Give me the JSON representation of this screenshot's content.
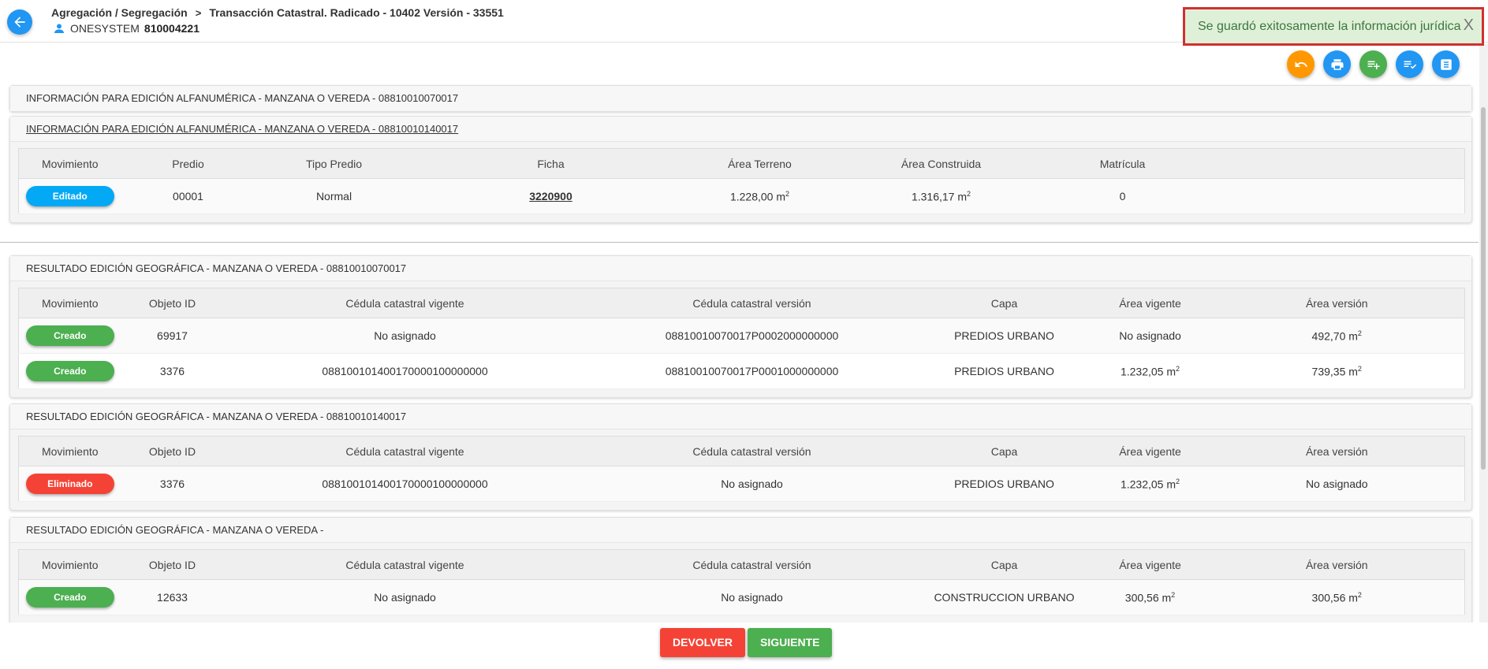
{
  "header": {
    "breadcrumb_section": "Agregación / Segregación",
    "breadcrumb_page": "Transacción Catastral. Radicado - 10402 Versión - 33551",
    "user_name": "ONESYSTEM",
    "user_id": "810004221"
  },
  "toast": {
    "message": "Se guardó exitosamente la información jurídica",
    "close": "X"
  },
  "toolbar": [
    {
      "icon": "undo-icon",
      "color": "#ff9800"
    },
    {
      "icon": "print-icon",
      "color": "#2196f3"
    },
    {
      "icon": "add-list-icon",
      "color": "#4caf50"
    },
    {
      "icon": "checklist-icon",
      "color": "#2196f3"
    },
    {
      "icon": "document-icon",
      "color": "#2196f3"
    }
  ],
  "alfa": {
    "panel1_title": "INFORMACIÓN PARA EDICIÓN ALFANUMÉRICA - MANZANA O VEREDA - 08810010070017",
    "panel2_title": "INFORMACIÓN PARA EDICIÓN ALFANUMÉRICA - MANZANA O VEREDA - 08810010140017",
    "headers": {
      "mov": "Movimiento",
      "predio": "Predio",
      "tipo": "Tipo Predio",
      "ficha": "Ficha",
      "area_terreno": "Área Terreno",
      "area_construida": "Área Construida",
      "matricula": "Matrícula"
    },
    "row": {
      "mov": "Editado",
      "predio": "00001",
      "tipo": "Normal",
      "ficha": "3220900",
      "area_terreno": "1.228,00 m",
      "area_construida": "1.316,17 m",
      "matricula": "0"
    }
  },
  "geo_headers": {
    "mov": "Movimiento",
    "objeto": "Objeto ID",
    "cedula_vigente": "Cédula catastral vigente",
    "cedula_version": "Cédula catastral versión",
    "capa": "Capa",
    "area_vigente": "Área vigente",
    "area_version": "Área versión"
  },
  "unit_sup": "2",
  "geo1": {
    "title": "RESULTADO EDICIÓN GEOGRÁFICA - MANZANA O VEREDA - 08810010070017",
    "rows": [
      {
        "mov": "Creado",
        "objeto": "69917",
        "cedula_vigente": "No asignado",
        "cedula_version": "08810010070017P0002000000000",
        "capa": "PREDIOS URBANO",
        "area_vigente": "No asignado",
        "area_version": "492,70 m"
      },
      {
        "mov": "Creado",
        "objeto": "3376",
        "cedula_vigente": "088100101400170000100000000",
        "cedula_version": "08810010070017P0001000000000",
        "capa": "PREDIOS URBANO",
        "area_vigente": "1.232,05 m",
        "area_version": "739,35 m"
      }
    ]
  },
  "geo2": {
    "title": "RESULTADO EDICIÓN GEOGRÁFICA - MANZANA O VEREDA - 08810010140017",
    "rows": [
      {
        "mov": "Eliminado",
        "objeto": "3376",
        "cedula_vigente": "088100101400170000100000000",
        "cedula_version": "No asignado",
        "capa": "PREDIOS URBANO",
        "area_vigente": "1.232,05 m",
        "area_version": "No asignado"
      }
    ]
  },
  "geo3": {
    "title": "RESULTADO EDICIÓN GEOGRÁFICA - MANZANA O VEREDA -",
    "rows": [
      {
        "mov": "Creado",
        "objeto": "12633",
        "cedula_vigente": "No asignado",
        "cedula_version": "No asignado",
        "capa": "CONSTRUCCION URBANO",
        "area_vigente": "300,56 m",
        "area_version": "300,56 m"
      }
    ]
  },
  "footer": {
    "devolver": "DEVOLVER",
    "siguiente": "SIGUIENTE"
  }
}
